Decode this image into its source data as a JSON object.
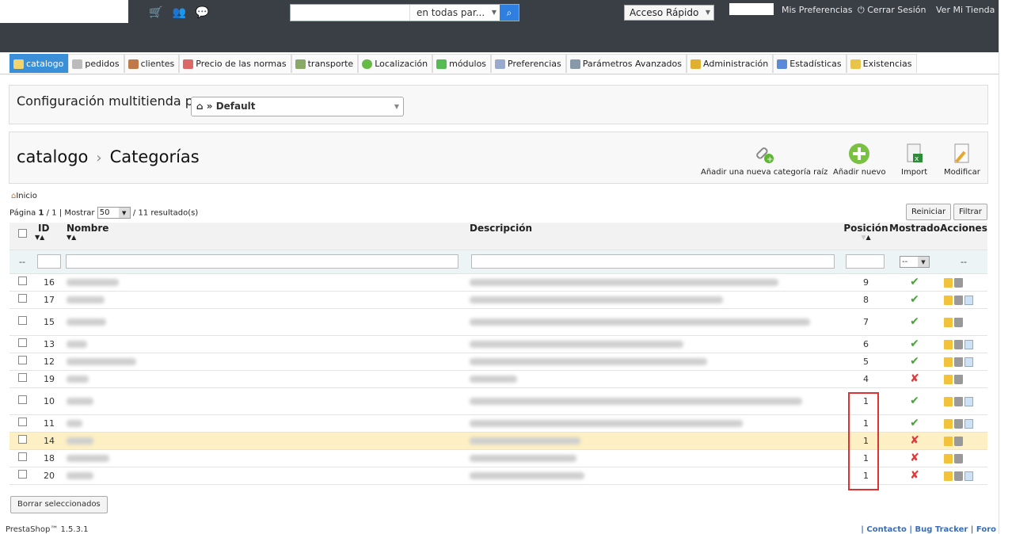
{
  "header": {
    "search_scope": "en todas par...",
    "quick_access": "Acceso Rápido",
    "links": [
      "Mis Preferencias",
      "Cerrar Sesión",
      "Ver Mi Tienda"
    ]
  },
  "tabs": [
    "catalogo",
    "pedidos",
    "clientes",
    "Precio de las normas",
    "transporte",
    "Localización",
    "módulos",
    "Preferencias",
    "Parámetros Avanzados",
    "Administración",
    "Estadísticas",
    "Existencias"
  ],
  "multistore": {
    "label": "Configuración multitienda para",
    "value": "» Default"
  },
  "breadcrumb": {
    "parent": "catalogo",
    "current": "Categorías"
  },
  "toolbar": {
    "add_root": "Añadir una nueva categoría raíz",
    "add_new": "Añadir nuevo",
    "import": "Import",
    "modify": "Modificar"
  },
  "home_link": "Inicio",
  "pager": {
    "page_prefix": "Página",
    "page": "1",
    "of": "/ 1",
    "show_label": "| Mostrar",
    "per_page": "50",
    "results": "/ 11 resultado(s)"
  },
  "buttons": {
    "reset": "Reiniciar",
    "filter": "Filtrar",
    "delete_selected": "Borrar seleccionados"
  },
  "columns": {
    "id": "ID",
    "name": "Nombre",
    "description": "Descripción",
    "position": "Posición",
    "shown": "Mostrado",
    "actions": "Acciones"
  },
  "filter": {
    "dash": "--",
    "shown_select": "--",
    "actions_dash": "--"
  },
  "rows": [
    {
      "id": "16",
      "position": "9",
      "shown": true,
      "actions": 2
    },
    {
      "id": "17",
      "position": "8",
      "shown": true,
      "actions": 3
    },
    {
      "id": "15",
      "position": "7",
      "shown": true,
      "actions": 2
    },
    {
      "id": "13",
      "position": "6",
      "shown": true,
      "actions": 3
    },
    {
      "id": "12",
      "position": "5",
      "shown": true,
      "actions": 3
    },
    {
      "id": "19",
      "position": "4",
      "shown": false,
      "actions": 2
    },
    {
      "id": "10",
      "position": "1",
      "shown": true,
      "actions": 3
    },
    {
      "id": "11",
      "position": "1",
      "shown": true,
      "actions": 3
    },
    {
      "id": "14",
      "position": "1",
      "shown": false,
      "actions": 2
    },
    {
      "id": "18",
      "position": "1",
      "shown": false,
      "actions": 2
    },
    {
      "id": "20",
      "position": "1",
      "shown": false,
      "actions": 3
    }
  ],
  "footer": {
    "version": "PrestaShop™ 1.5.3.1",
    "links": "| Contacto | Bug Tracker | Foro"
  },
  "colors": {
    "topbar": "#3a3f46",
    "active_tab": "#3a8fd9",
    "highlight_row": "#fdf0c4",
    "check": "#4aa33a",
    "cross": "#e03a3a"
  }
}
